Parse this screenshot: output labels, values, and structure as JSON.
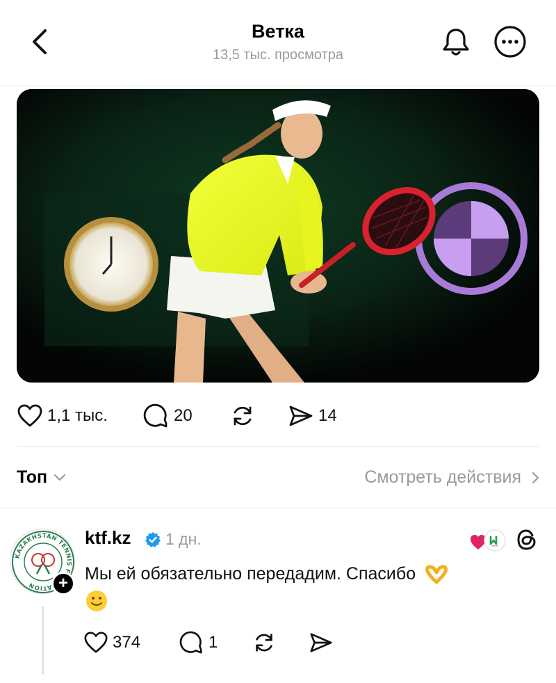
{
  "header": {
    "title": "Ветка",
    "views": "13,5 тыс. просмотра"
  },
  "post": {
    "actions": {
      "likes": "1,1 тыс.",
      "replies": "20",
      "shares": "14"
    }
  },
  "sort": {
    "label": "Топ",
    "view_activity": "Смотреть действия"
  },
  "reply": {
    "username": "ktf.kz",
    "time": "1 дн.",
    "text": "Мы ей обязательно передадим. Спасибо",
    "avatar_text": "KAZAKHSTAN TENNIS FEDERATION",
    "actions": {
      "likes": "374",
      "replies": "1"
    }
  },
  "colors": {
    "verified": "#1d9bf0",
    "muted_text": "#9a9a9a",
    "avatar_green": "#2e7d4f",
    "reaction_heart": "#e0245e"
  }
}
